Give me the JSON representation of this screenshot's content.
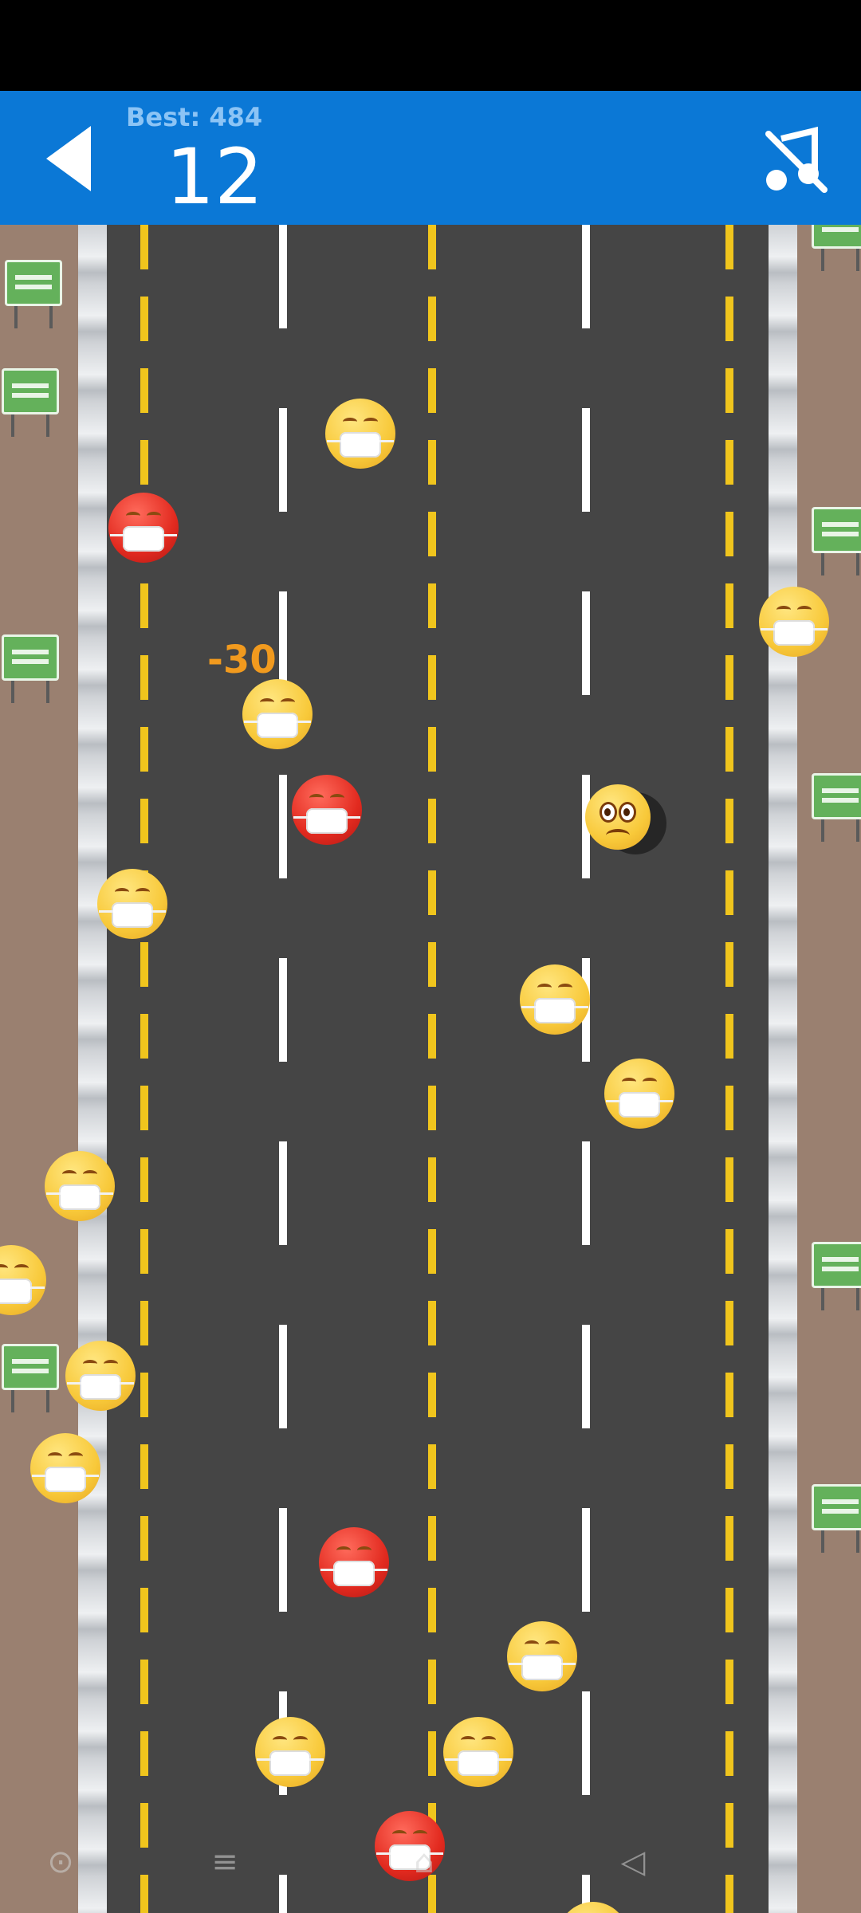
{
  "header": {
    "best_label": "Best: 484",
    "score": "12",
    "back_icon": "back-arrow-icon",
    "music_icon": "music-off-icon"
  },
  "game": {
    "penalty_text": "-30",
    "player_icon": "worried-face-icon",
    "obstacle_icon": "masked-face-icon",
    "colors": {
      "header_bg": "#0b78d6",
      "road": "#454545",
      "yellow_line": "#f0c51d",
      "white_line": "#ffffff",
      "dirt": "#9a8070",
      "obstacle_yellow": "#f8c93a",
      "obstacle_red": "#e22a1f",
      "penalty": "#f19a1e"
    }
  },
  "navbar": {
    "icons": [
      "nav-recent-icon",
      "nav-menu-icon",
      "nav-home-icon",
      "nav-back-icon"
    ]
  }
}
